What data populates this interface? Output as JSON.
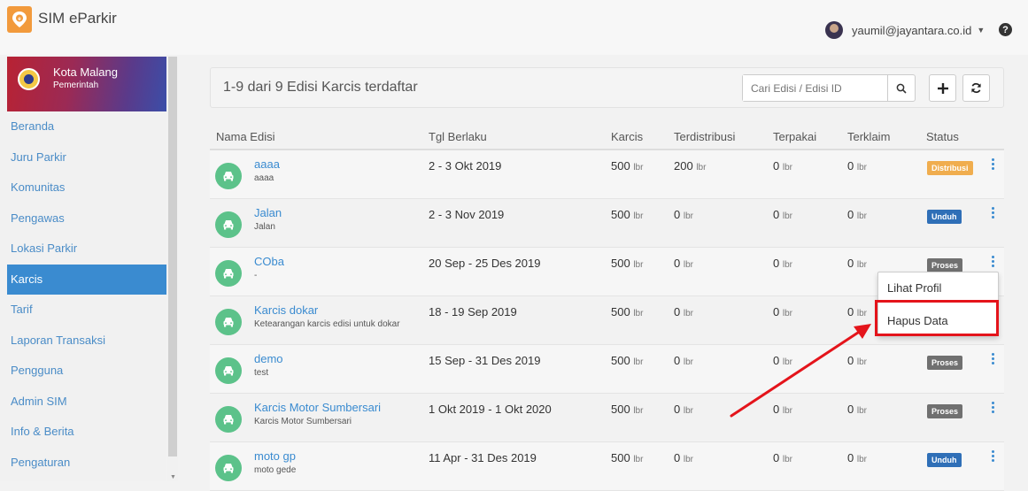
{
  "app": {
    "title": "SIM eParkir",
    "accent": "#3a8bd0",
    "logo_color": "#f29a3c"
  },
  "user": {
    "email": "yaumil@jayantara.co.id"
  },
  "org": {
    "name": "Kota Malang",
    "subtitle": "Pemerintah"
  },
  "sidebar": {
    "items": [
      {
        "label": "Beranda",
        "active": false
      },
      {
        "label": "Juru Parkir",
        "active": false
      },
      {
        "label": "Komunitas",
        "active": false
      },
      {
        "label": "Pengawas",
        "active": false
      },
      {
        "label": "Lokasi Parkir",
        "active": false
      },
      {
        "label": "Karcis",
        "active": true
      },
      {
        "label": "Tarif",
        "active": false
      },
      {
        "label": "Laporan Transaksi",
        "active": false
      },
      {
        "label": "Pengguna",
        "active": false
      },
      {
        "label": "Admin SIM",
        "active": false
      },
      {
        "label": "Info & Berita",
        "active": false
      },
      {
        "label": "Pengaturan",
        "active": false
      }
    ]
  },
  "panel": {
    "count_text": "1-9 dari 9 Edisi Karcis terdaftar",
    "search_placeholder": "Cari Edisi / Edisi ID",
    "icons": [
      "search-icon",
      "plus-icon",
      "refresh-icon"
    ]
  },
  "table": {
    "headers": {
      "nama": "Nama Edisi",
      "tgl": "Tgl Berlaku",
      "karcis": "Karcis",
      "terdistribusi": "Terdistribusi",
      "terpakai": "Terpakai",
      "terklaim": "Terklaim",
      "status": "Status"
    },
    "unit": "lbr",
    "rows": [
      {
        "name": "aaaa",
        "desc": "aaaa",
        "tgl": "2 - 3 Okt 2019",
        "karcis": "500",
        "terdistribusi": "200",
        "terpakai": "0",
        "terklaim": "0",
        "status": "Distribusi",
        "status_color": "#f0ad4e"
      },
      {
        "name": "Jalan",
        "desc": "Jalan",
        "tgl": "2 - 3 Nov 2019",
        "karcis": "500",
        "terdistribusi": "0",
        "terpakai": "0",
        "terklaim": "0",
        "status": "Unduh",
        "status_color": "#2f6fb7"
      },
      {
        "name": "COba",
        "desc": "-",
        "tgl": "20 Sep - 25 Des 2019",
        "karcis": "500",
        "terdistribusi": "0",
        "terpakai": "0",
        "terklaim": "0",
        "status": "Proses",
        "status_color": "#707070"
      },
      {
        "name": "Karcis dokar",
        "desc": "Ketearangan karcis edisi untuk dokar",
        "tgl": "18 - 19 Sep 2019",
        "karcis": "500",
        "terdistribusi": "0",
        "terpakai": "0",
        "terklaim": "0",
        "status": "",
        "status_color": ""
      },
      {
        "name": "demo",
        "desc": "test",
        "tgl": "15 Sep - 31 Des 2019",
        "karcis": "500",
        "terdistribusi": "0",
        "terpakai": "0",
        "terklaim": "0",
        "status": "Proses",
        "status_color": "#707070"
      },
      {
        "name": "Karcis Motor Sumbersari",
        "desc": "Karcis Motor Sumbersari",
        "tgl": "1 Okt 2019 - 1 Okt 2020",
        "karcis": "500",
        "terdistribusi": "0",
        "terpakai": "0",
        "terklaim": "0",
        "status": "Proses",
        "status_color": "#707070"
      },
      {
        "name": "moto gp",
        "desc": "moto gede",
        "tgl": "11 Apr - 31 Des 2019",
        "karcis": "500",
        "terdistribusi": "0",
        "terpakai": "0",
        "terklaim": "0",
        "status": "Unduh",
        "status_color": "#2f6fb7"
      }
    ]
  },
  "dropdown": {
    "items": [
      "Lihat Profil",
      "Hapus Data"
    ]
  },
  "annotation": {
    "highlight_color": "#e4141b"
  }
}
